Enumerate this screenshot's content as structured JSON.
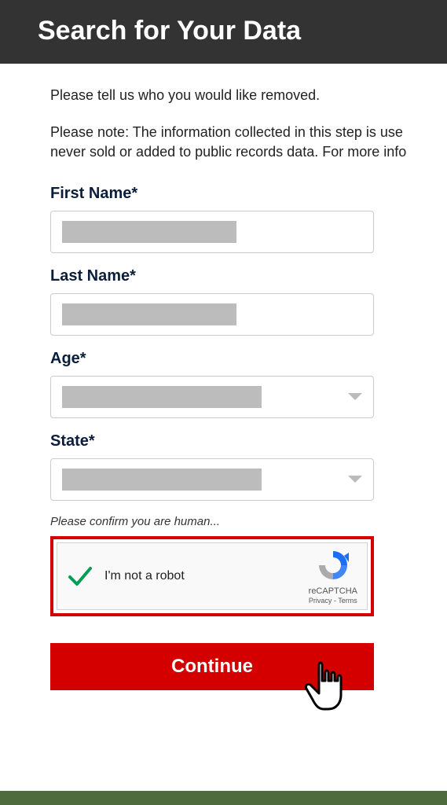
{
  "header": {
    "title": "Search for Your Data"
  },
  "intro": "Please tell us who you would like removed.",
  "note_line1": "Please note: The information collected in this step is use",
  "note_line2": "never sold or added to public records data. For more info",
  "fields": {
    "first_name": {
      "label": "First Name*"
    },
    "last_name": {
      "label": "Last Name*"
    },
    "age": {
      "label": "Age*"
    },
    "state": {
      "label": "State*"
    }
  },
  "captcha": {
    "prompt": "Please confirm you are human...",
    "text": "I'm not a robot",
    "brand": "reCAPTCHA",
    "privacy": "Privacy",
    "terms": "Terms"
  },
  "button": {
    "continue": "Continue"
  }
}
